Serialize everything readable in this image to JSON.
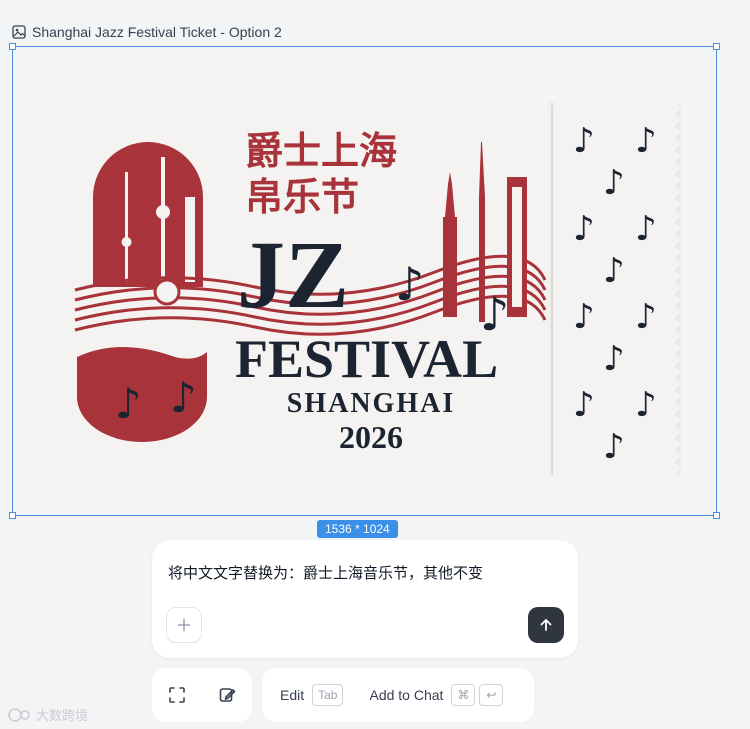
{
  "canvas": {
    "title": "Shanghai Jazz Festival Ticket - Option 2",
    "dimensions_label": "1536 * 1024"
  },
  "ticket": {
    "chinese_line1": "爵士上海",
    "chinese_line2": "帛乐节",
    "jz": "JZ",
    "festival": "FESTIVAL",
    "city": "SHANGHAI",
    "year": "2026",
    "colors": {
      "red": "#a8333a",
      "navy": "#1b2430",
      "paper": "#f4f3f1"
    }
  },
  "composer": {
    "message": "将中文文字替换为：爵士上海音乐节，其他不变",
    "send_icon": "arrow-up-icon",
    "add_icon": "plus-icon"
  },
  "toolbar": {
    "edit_label": "Edit",
    "edit_key": "Tab",
    "add_to_chat_label": "Add to Chat",
    "cmd_key": "⌘",
    "enter_key": "↩"
  },
  "watermark": {
    "text": "大数跨境"
  }
}
